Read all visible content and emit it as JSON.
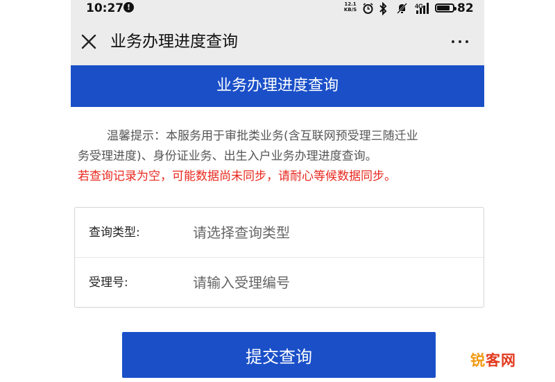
{
  "status_bar": {
    "time": "10:27",
    "net_speed_top": "12.1",
    "net_speed_unit": "KB/S",
    "battery_level": "82",
    "battery_fraction": 0.82
  },
  "nav": {
    "title": "业务办理进度查询"
  },
  "banner": {
    "title": "业务办理进度查询"
  },
  "notice": {
    "line1": "温馨提示：本服务用于审批类业务(含互联网预受理三随迁业",
    "line2": "务受理进度)、身份证业务、出生入户业务办理进度查询。",
    "warning": "若查询记录为空，可能数据尚未同步，请耐心等候数据同步。"
  },
  "form": {
    "query_type_label": "查询类型:",
    "query_type_placeholder": "请选择查询类型",
    "accept_no_label": "受理号:",
    "accept_no_placeholder": "请输入受理编号"
  },
  "submit_label": "提交查询",
  "watermark": {
    "part_a": "锐",
    "part_b": "客网"
  },
  "colors": {
    "primary": "#1a4fc8",
    "warning": "#e8281e",
    "nav_bg": "#ececec"
  },
  "icons": [
    "info-icon",
    "alarm-icon",
    "bluetooth-icon",
    "mute-icon",
    "signal-icon",
    "battery-icon",
    "close-icon",
    "more-icon"
  ]
}
